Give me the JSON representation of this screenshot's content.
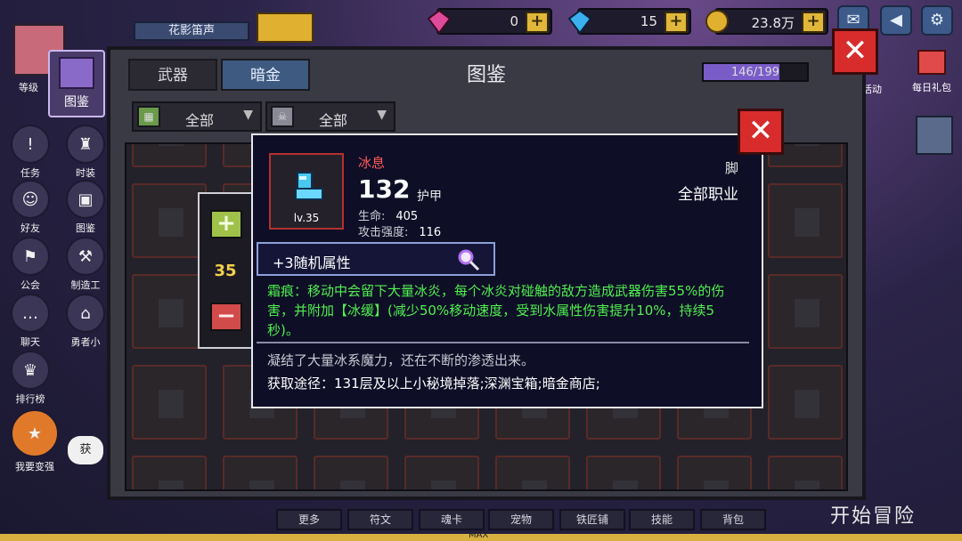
{
  "topbar": {
    "player_name": "花影笛声",
    "gems_pink": "0",
    "gems_blue": "15",
    "gold": "23.8万"
  },
  "sidebar": {
    "items": [
      {
        "label": "等级",
        "icon": "level-icon"
      },
      {
        "label": "图鉴",
        "icon": "codex-icon"
      },
      {
        "label": "任务",
        "icon": "quest-icon"
      },
      {
        "label": "时装",
        "icon": "costume-icon"
      },
      {
        "label": "好友",
        "icon": "friend-icon"
      },
      {
        "label": "图鉴",
        "icon": "codex-icon"
      },
      {
        "label": "公会",
        "icon": "guild-icon"
      },
      {
        "label": "制造工",
        "icon": "craft-icon"
      },
      {
        "label": "聊天",
        "icon": "chat-icon"
      },
      {
        "label": "勇者小",
        "icon": "hero-icon"
      },
      {
        "label": "排行榜",
        "icon": "trophy-icon"
      },
      {
        "label": "我要变强",
        "icon": "powerup-icon"
      },
      {
        "label": "获",
        "icon": "obtain-icon"
      }
    ]
  },
  "right": {
    "event_label": "活动",
    "gift_label": "每日礼包"
  },
  "panel": {
    "title": "图鉴",
    "tabs": [
      {
        "label": "武器",
        "active": false
      },
      {
        "label": "暗金",
        "active": true
      }
    ],
    "progress_text": "146/199",
    "progress_value": 0.734,
    "filters": [
      {
        "label": "全部",
        "icon": "class-icon"
      },
      {
        "label": "全部",
        "icon": "monster-icon"
      }
    ]
  },
  "quantity": {
    "value": "35"
  },
  "item": {
    "name": "冰息",
    "level": "lv.35",
    "stat_value": "132",
    "stat_type": "护甲",
    "stats": [
      {
        "label": "生命:",
        "value": "405"
      },
      {
        "label": "攻击强度:",
        "value": "116"
      }
    ],
    "slot": "脚",
    "class": "全部职业",
    "random_attr": "+3随机属性",
    "effect": "霜痕：移动中会留下大量冰炎，每个冰炎对碰触的敌方造成武器伤害55%的伤害，并附加【冰缓】(减少50%移动速度，受到水属性伤害提升10%，持续5秒)。",
    "flavor": "凝结了大量冰系魔力，还在不断的渗透出来。",
    "source": "获取途径：131层及以上小秘境掉落;深渊宝箱;暗金商店;"
  },
  "bottom": {
    "buttons": [
      "更多",
      "符文",
      "魂卡",
      "宠物",
      "铁匠铺",
      "技能",
      "背包"
    ],
    "max_label": "MAX",
    "start_label": "开始冒险"
  },
  "colors": {
    "accent_red": "#d82c2c",
    "effect_green": "#4ff04f",
    "name_red": "#ff5a5a",
    "qty_yellow": "#f3cf4a"
  }
}
